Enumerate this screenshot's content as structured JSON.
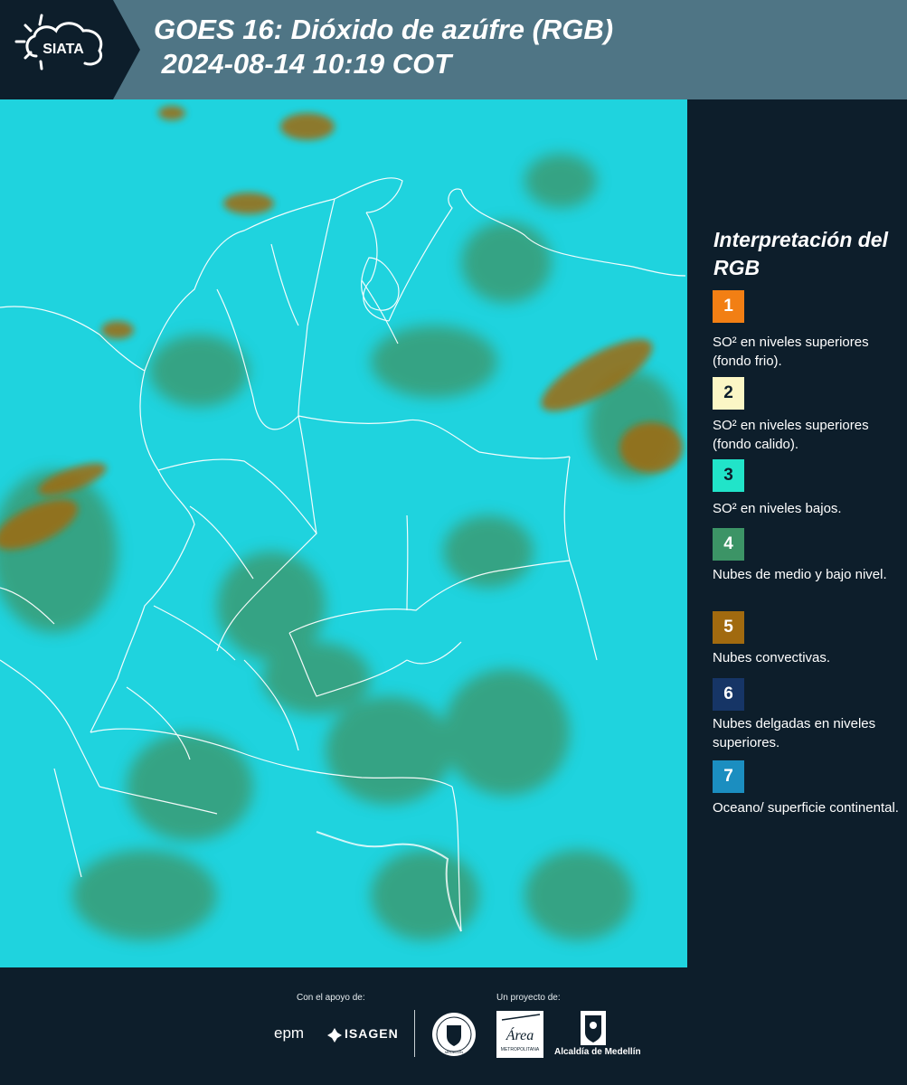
{
  "header": {
    "logo_text": "SIATA",
    "title_line1": "GOES 16: Dióxido de azúfre (RGB)",
    "title_line2": " 2024-08-14 10:19 COT"
  },
  "legend": {
    "title": "Interpretación del RGB",
    "items": [
      {
        "number": "1",
        "color": "#f27f14",
        "text": "SO² en niveles superiores (fondo frio)."
      },
      {
        "number": "2",
        "color": "#fbf6c5",
        "text": "SO² en niveles superiores (fondo calido)."
      },
      {
        "number": "3",
        "color": "#21e4c9",
        "text": "SO² en niveles bajos."
      },
      {
        "number": "4",
        "color": "#3c9466",
        "text": "Nubes de medio y bajo nivel."
      },
      {
        "number": "5",
        "color": "#a16a0f",
        "text": "Nubes convectivas."
      },
      {
        "number": "6",
        "color": "#163566",
        "text": "Nubes delgadas en niveles superiores."
      },
      {
        "number": "7",
        "color": "#1b8ec0",
        "text": "Oceano/ superficie continental."
      }
    ]
  },
  "footer": {
    "support_label": "Con el apoyo de:",
    "project_label": "Un proyecto de:",
    "partners": [
      "epm",
      "ISAGEN"
    ],
    "alcaldia": "Alcaldía de Medellín",
    "seal_text": "MEDELLÍN",
    "area_text": "Área",
    "area_subtext": "METROPOLITANA"
  },
  "colors": {
    "header_bg": "#4f7585",
    "dark_bg": "#0d1e2b",
    "map_cyan": "#1fd3de",
    "cloud_green": "#3c9466",
    "cloud_brown": "#a16a0f"
  }
}
